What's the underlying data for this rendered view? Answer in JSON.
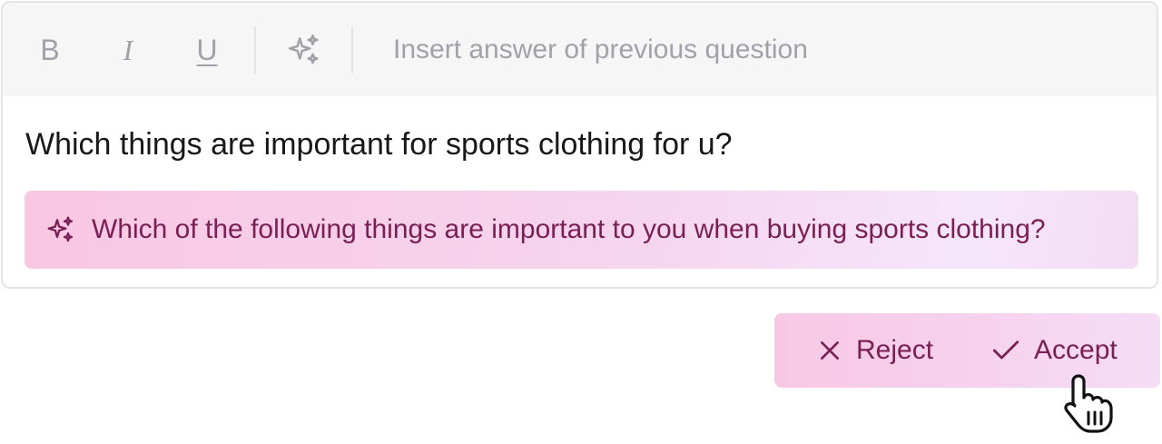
{
  "toolbar": {
    "bold_label": "B",
    "italic_label": "I",
    "underline_label": "U",
    "magic_icon": "sparkles-icon",
    "insert_label": "Insert answer of previous question"
  },
  "editor": {
    "question_text": "Which things are important for sports clothing for u?"
  },
  "suggestion": {
    "icon": "sparkles-icon",
    "text": "Which of the following things are important to you when buying sports clothing?"
  },
  "actions": {
    "reject_label": "Reject",
    "reject_icon": "x-icon",
    "accept_label": "Accept",
    "accept_icon": "check-icon"
  },
  "colors": {
    "accent_text": "#7a1f55",
    "suggestion_bg_start": "#f8c7e2",
    "suggestion_bg_end": "#f5e6fb",
    "muted": "#a1a1aa"
  }
}
